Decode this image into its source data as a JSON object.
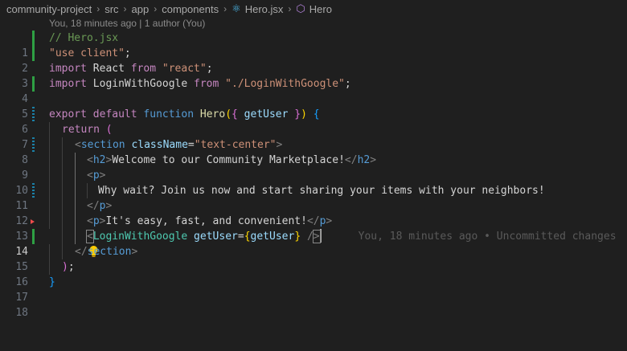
{
  "breadcrumb": {
    "items": [
      "community-project",
      "src",
      "app",
      "components",
      "Hero.jsx",
      "Hero"
    ],
    "icons": {
      "file": "react-icon",
      "symbol": "cube-icon"
    }
  },
  "codelens": "You, 18 minutes ago | 1 author (You)",
  "editor": {
    "line_numbers": [
      "1",
      "2",
      "3",
      "4",
      "5",
      "6",
      "7",
      "8",
      "9",
      "10",
      "11",
      "12",
      "13",
      "14",
      "15",
      "16",
      "17",
      "18"
    ],
    "current_line": "14",
    "blame": "You, 18 minutes ago • Uncommitted changes",
    "code": {
      "l1": {
        "comment": "// Hero.jsx"
      },
      "l2": {
        "str": "\"use client\"",
        "semi": ";"
      },
      "l3": {
        "import": "import",
        "name": " React ",
        "from": "from",
        "str": " \"react\"",
        "semi": ";"
      },
      "l4": {
        "import": "import",
        "name": " LoginWithGoogle ",
        "from": "from",
        "str": " \"./LoginWithGoogle\"",
        "semi": ";"
      },
      "l6": {
        "export": "export",
        "default": " default",
        "function": " function",
        "fname": " Hero",
        "open_paren": "(",
        "open_brace": "{ ",
        "param": "getUser",
        "close_brace": " }",
        "close_paren": ")",
        "open_body": " {"
      },
      "l7": {
        "return": "return",
        "paren": " ("
      },
      "l8": {
        "lt": "<",
        "tag": "section",
        "attr": " className",
        "eq": "=",
        "val": "\"text-center\"",
        "gt": ">"
      },
      "l9": {
        "lt": "<",
        "tag": "h2",
        "gt": ">",
        "text": "Welcome to our Community Marketplace!",
        "close_lt": "</",
        "close_tag": "h2",
        "close_gt": ">"
      },
      "l10": {
        "lt": "<",
        "tag": "p",
        "gt": ">"
      },
      "l11": {
        "text": "Why wait? Join us now and start sharing your items with your neighbors!"
      },
      "l12": {
        "lt": "</",
        "tag": "p",
        "gt": ">"
      },
      "l13": {
        "lt": "<",
        "tag": "p",
        "gt": ">",
        "text": "It's easy, fast, and convenient!",
        "close_lt": "</",
        "close_tag": "p",
        "close_gt": ">"
      },
      "l14": {
        "lt": "<",
        "tag": "LoginWithGoogle",
        "attr": " getUser",
        "eq": "=",
        "open": "{",
        "val": "getUser",
        "close": "}",
        "end": " /",
        "gt": ">"
      },
      "l15": {
        "lt": "</",
        "tag": "section",
        "gt": ">"
      },
      "l16": {
        "paren": ")",
        "semi": ";"
      },
      "l17": {
        "brace": "}"
      }
    }
  }
}
